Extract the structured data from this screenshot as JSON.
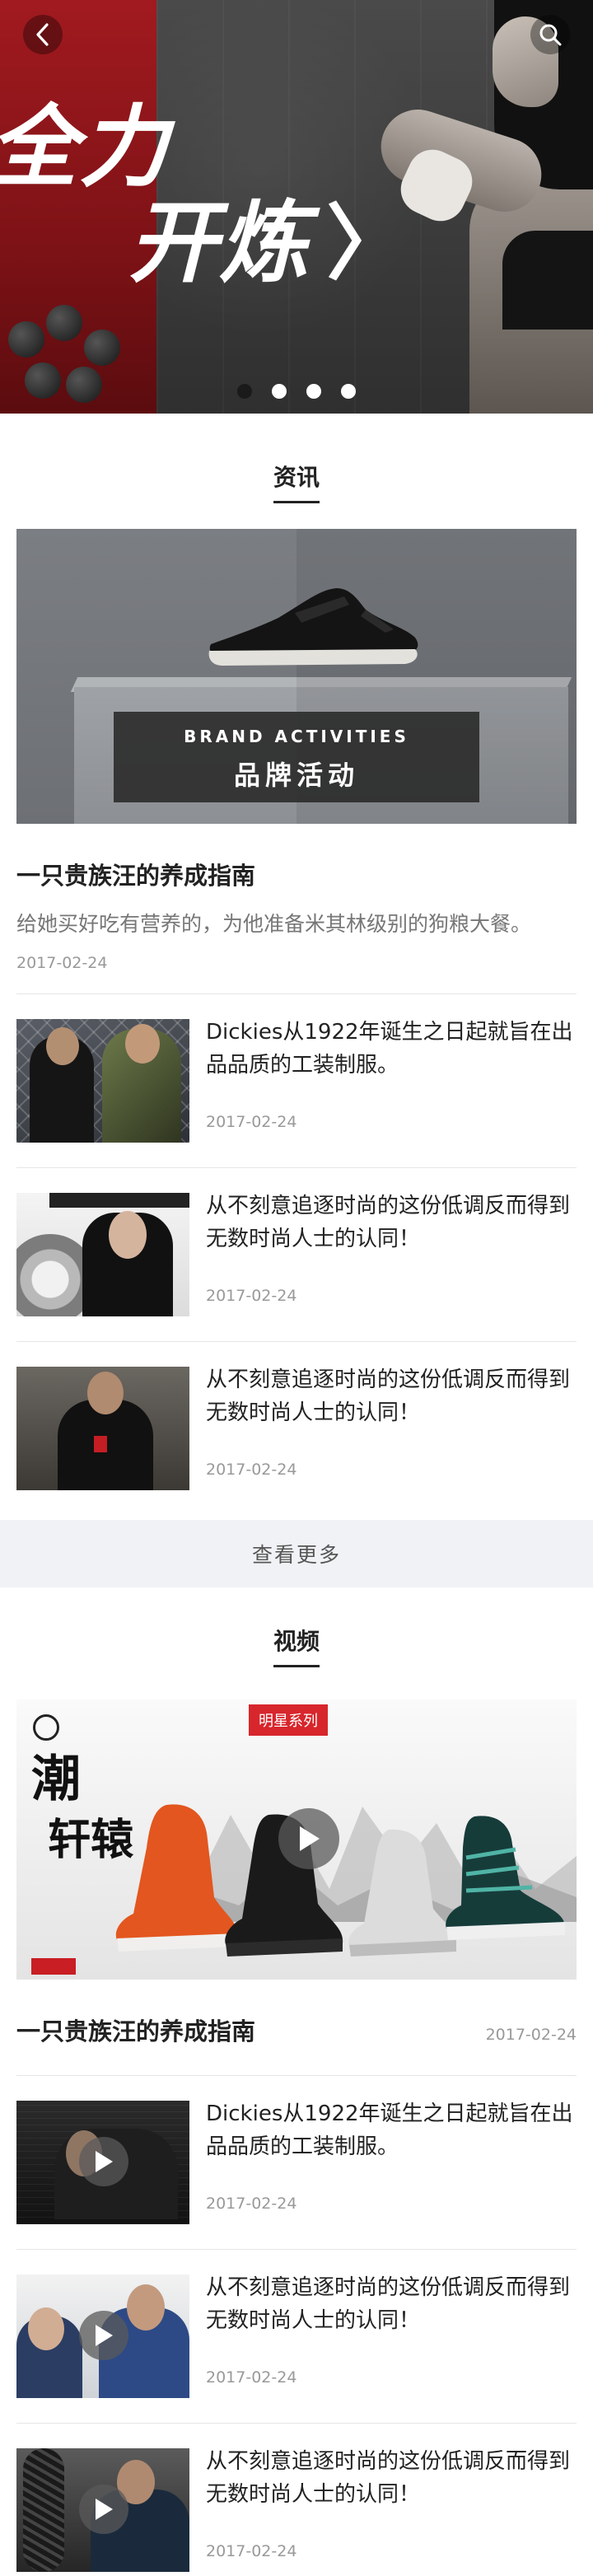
{
  "banner": {
    "slogan_line1": "全力",
    "slogan_line2": "开炼",
    "slogan_arrow": "〉",
    "slide_count": 4,
    "active_slide": 3
  },
  "news": {
    "section_title": "资讯",
    "featured": {
      "caption_en": "BRAND ACTIVITIES",
      "caption_cn": "品牌活动",
      "title": "一只贵族汪的养成指南",
      "description": "给她买好吃有营养的，为他准备米其林级别的狗粮大餐。",
      "date": "2017-02-24"
    },
    "items": [
      {
        "title": "Dickies从1922年诞生之日起就旨在出品品质的工装制服。",
        "date": "2017-02-24"
      },
      {
        "title": "从不刻意追逐时尚的这份低调反而得到无数时尚人士的认同！",
        "date": "2017-02-24"
      },
      {
        "title": "从不刻意追逐时尚的这份低调反而得到无数时尚人士的认同！",
        "date": "2017-02-24"
      }
    ],
    "more_label": "查看更多"
  },
  "video": {
    "section_title": "视频",
    "featured": {
      "badge": "明星系列",
      "ink_text_1": "潮",
      "ink_text_2": "轩辕",
      "title": "一只贵族汪的养成指南",
      "date": "2017-02-24"
    },
    "items": [
      {
        "title": "Dickies从1922年诞生之日起就旨在出品品质的工装制服。",
        "date": "2017-02-24"
      },
      {
        "title": "从不刻意追逐时尚的这份低调反而得到无数时尚人士的认同！",
        "date": "2017-02-24"
      },
      {
        "title": "从不刻意追逐时尚的这份低调反而得到无数时尚人士的认同！",
        "date": "2017-02-24"
      }
    ]
  },
  "icons": {
    "back": "back-arrow-icon",
    "search": "search-icon",
    "play": "play-icon"
  },
  "colors": {
    "badge_red": "#d7262c",
    "more_bg": "#f0f2f5",
    "date_gray": "#999999"
  }
}
